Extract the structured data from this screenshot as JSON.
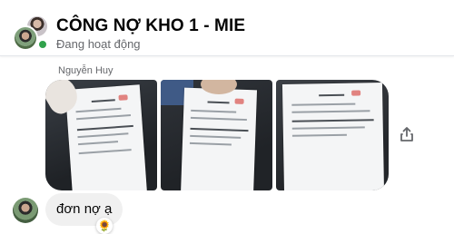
{
  "header": {
    "title": "CÔNG NỢ KHO 1 - MIE",
    "status": "Đang hoạt động",
    "online_color": "#31a24c"
  },
  "messages": [
    {
      "sender": "Nguyễn Huy",
      "type": "photos",
      "photos": [
        {
          "icon": "invoice-photo-1"
        },
        {
          "icon": "invoice-photo-2"
        },
        {
          "icon": "invoice-photo-3"
        }
      ],
      "action_icon": "share-icon"
    },
    {
      "type": "text",
      "text": "đơn nợ ạ",
      "reaction": "🌻"
    }
  ]
}
